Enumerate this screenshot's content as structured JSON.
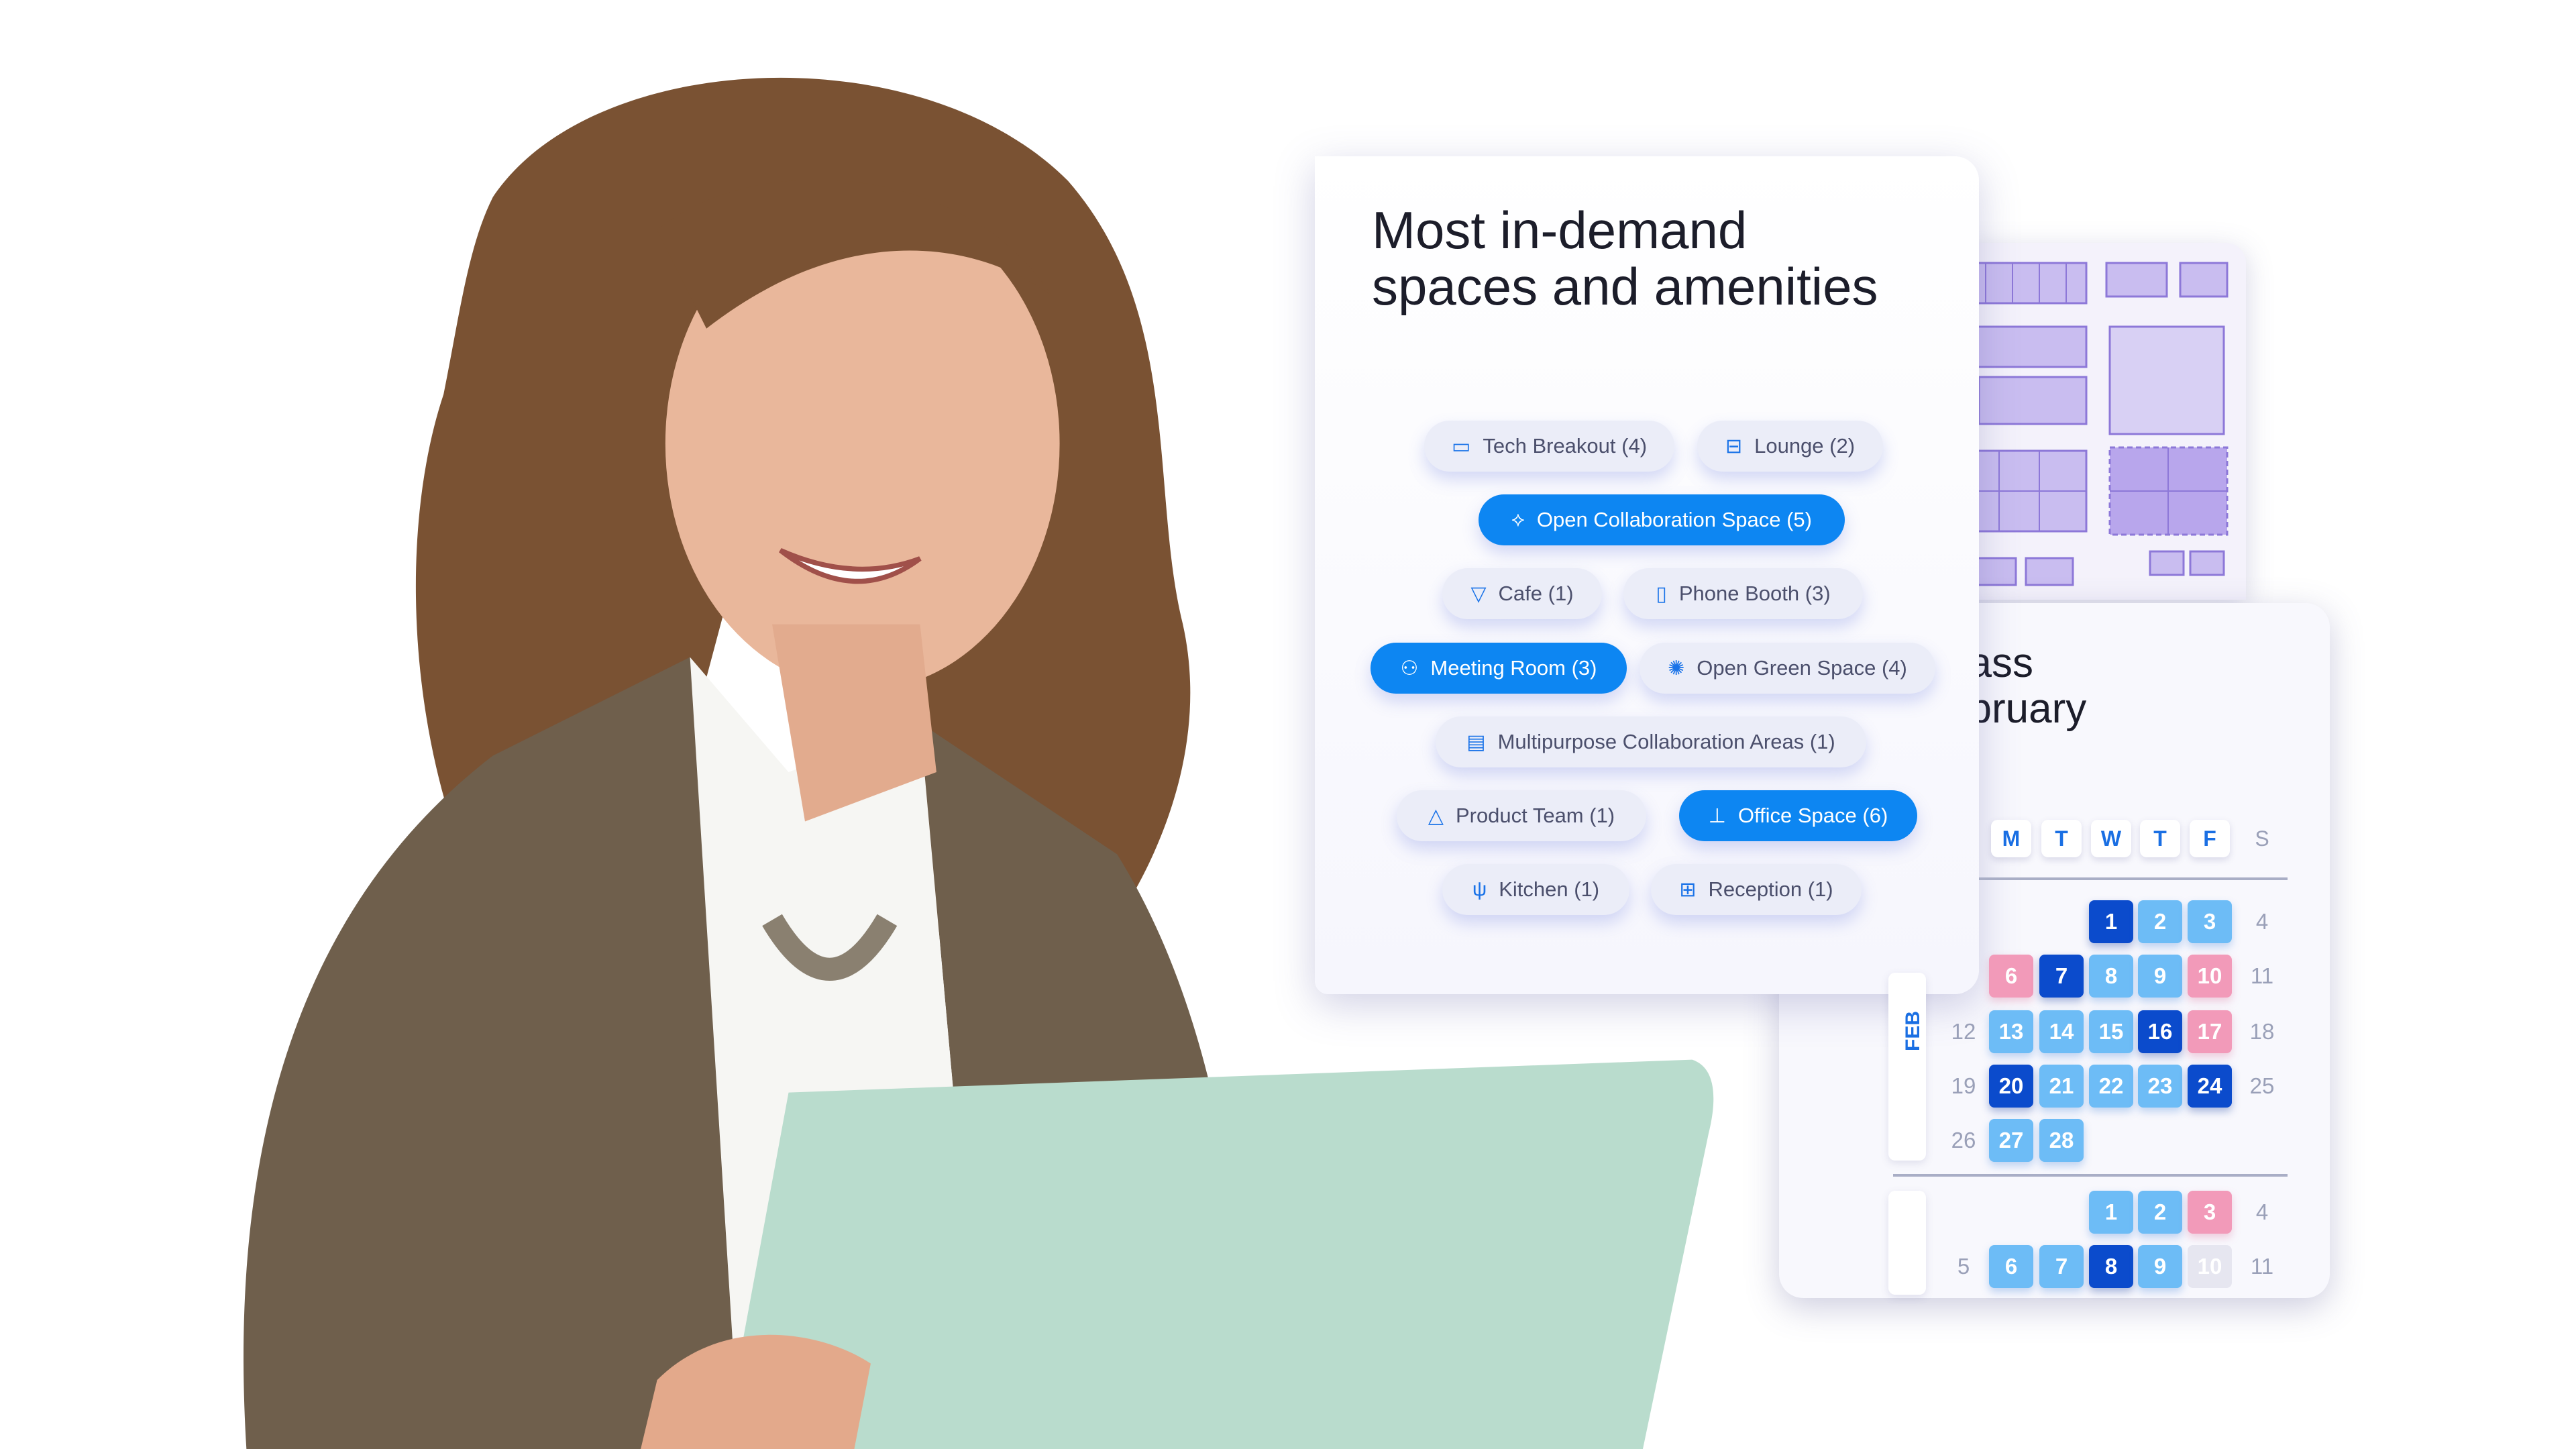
{
  "card": {
    "title_line1": "Most in-demand",
    "title_line2": "spaces and amenities",
    "chips": [
      {
        "label": "Tech Breakout (4)",
        "icon": "laptop-icon",
        "glyph": "▭",
        "active": false
      },
      {
        "label": "Lounge (2)",
        "icon": "sofa-icon",
        "glyph": "⊟",
        "active": false
      },
      {
        "label": "Open Collaboration Space (5)",
        "icon": "network-icon",
        "glyph": "⟡",
        "active": true
      },
      {
        "label": "Cafe (1)",
        "icon": "cup-icon",
        "glyph": "▽",
        "active": false
      },
      {
        "label": "Phone Booth (3)",
        "icon": "phone-booth-icon",
        "glyph": "▯",
        "active": false
      },
      {
        "label": "Meeting Room (3)",
        "icon": "meeting-icon",
        "glyph": "⚇",
        "active": true
      },
      {
        "label": "Open Green Space (4)",
        "icon": "sun-icon",
        "glyph": "✺",
        "active": false
      },
      {
        "label": "Multipurpose Collaboration Areas  (1)",
        "icon": "chat-icon",
        "glyph": "▤",
        "active": false
      },
      {
        "label": "Product Team (1)",
        "icon": "shapes-icon",
        "glyph": "△",
        "active": false
      },
      {
        "label": "Office Space (6)",
        "icon": "desk-icon",
        "glyph": "⊥",
        "active": true
      },
      {
        "label": "Kitchen (1)",
        "icon": "utensils-icon",
        "glyph": "ψ",
        "active": false
      },
      {
        "label": "Reception (1)",
        "icon": "reception-icon",
        "glyph": "⊞",
        "active": false
      }
    ]
  },
  "calendar": {
    "title_line1": "nass",
    "title_line2": "ebruary",
    "month_label": "FEB",
    "weekdays": [
      "M",
      "T",
      "W",
      "T",
      "F",
      "S"
    ],
    "colors": {
      "light": "#6dbcf6",
      "dark": "#0b4bcc",
      "pink": "#f29ab9",
      "gray": "#e6e6f0"
    },
    "feb": [
      [
        null,
        null,
        null,
        {
          "d": "1",
          "s": "dark"
        },
        {
          "d": "2",
          "s": "light"
        },
        {
          "d": "3",
          "s": "light"
        },
        {
          "d": "4",
          "s": "plain"
        }
      ],
      [
        null,
        {
          "d": "6",
          "s": "pink"
        },
        {
          "d": "7",
          "s": "dark"
        },
        {
          "d": "8",
          "s": "light"
        },
        {
          "d": "9",
          "s": "light"
        },
        {
          "d": "10",
          "s": "pink"
        },
        {
          "d": "11",
          "s": "plain"
        }
      ],
      [
        {
          "d": "12",
          "s": "plain"
        },
        {
          "d": "13",
          "s": "light"
        },
        {
          "d": "14",
          "s": "light"
        },
        {
          "d": "15",
          "s": "light"
        },
        {
          "d": "16",
          "s": "dark"
        },
        {
          "d": "17",
          "s": "pink"
        },
        {
          "d": "18",
          "s": "plain"
        }
      ],
      [
        {
          "d": "19",
          "s": "plain"
        },
        {
          "d": "20",
          "s": "dark"
        },
        {
          "d": "21",
          "s": "light"
        },
        {
          "d": "22",
          "s": "light"
        },
        {
          "d": "23",
          "s": "light"
        },
        {
          "d": "24",
          "s": "dark"
        },
        {
          "d": "25",
          "s": "plain"
        }
      ],
      [
        {
          "d": "26",
          "s": "plain"
        },
        {
          "d": "27",
          "s": "light"
        },
        {
          "d": "28",
          "s": "light"
        },
        null,
        null,
        null,
        null
      ]
    ],
    "mar": [
      [
        null,
        null,
        null,
        {
          "d": "1",
          "s": "light"
        },
        {
          "d": "2",
          "s": "light"
        },
        {
          "d": "3",
          "s": "pink"
        },
        {
          "d": "4",
          "s": "plain"
        }
      ],
      [
        {
          "d": "5",
          "s": "plain"
        },
        {
          "d": "6",
          "s": "light"
        },
        {
          "d": "7",
          "s": "light"
        },
        {
          "d": "8",
          "s": "dark"
        },
        {
          "d": "9",
          "s": "light"
        },
        {
          "d": "10",
          "s": "gray"
        },
        {
          "d": "11",
          "s": "plain"
        }
      ]
    ]
  }
}
